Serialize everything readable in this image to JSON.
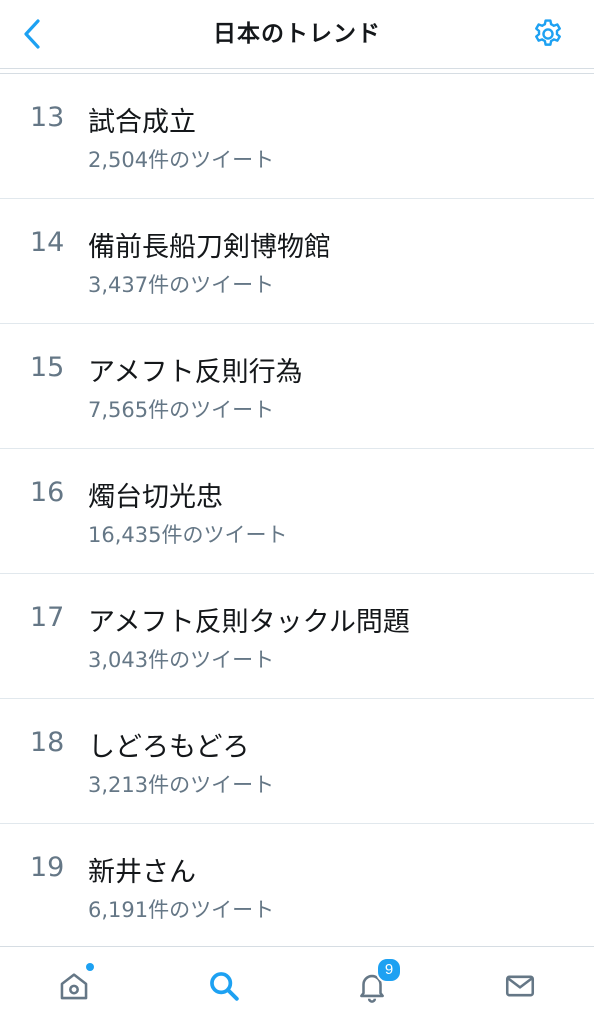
{
  "header": {
    "title": "日本のトレンド",
    "back_icon": "chevron-left-icon",
    "settings_icon": "gear-icon"
  },
  "colors": {
    "accent": "#1da1f2",
    "text": "#14171a",
    "muted": "#657786",
    "divider": "#e1e8ed"
  },
  "trends": [
    {
      "rank": "13",
      "name": "試合成立",
      "count": "2,504件のツイート"
    },
    {
      "rank": "14",
      "name": "備前長船刀剣博物館",
      "count": "3,437件のツイート"
    },
    {
      "rank": "15",
      "name": "アメフト反則行為",
      "count": "7,565件のツイート"
    },
    {
      "rank": "16",
      "name": "燭台切光忠",
      "count": "16,435件のツイート"
    },
    {
      "rank": "17",
      "name": "アメフト反則タックル問題",
      "count": "3,043件のツイート"
    },
    {
      "rank": "18",
      "name": "しどろもどろ",
      "count": "3,213件のツイート"
    },
    {
      "rank": "19",
      "name": "新井さん",
      "count": "6,191件のツイート"
    }
  ],
  "tabbar": {
    "notifications_badge": "9",
    "tabs": [
      "home-icon",
      "search-icon",
      "bell-icon",
      "mail-icon"
    ]
  }
}
